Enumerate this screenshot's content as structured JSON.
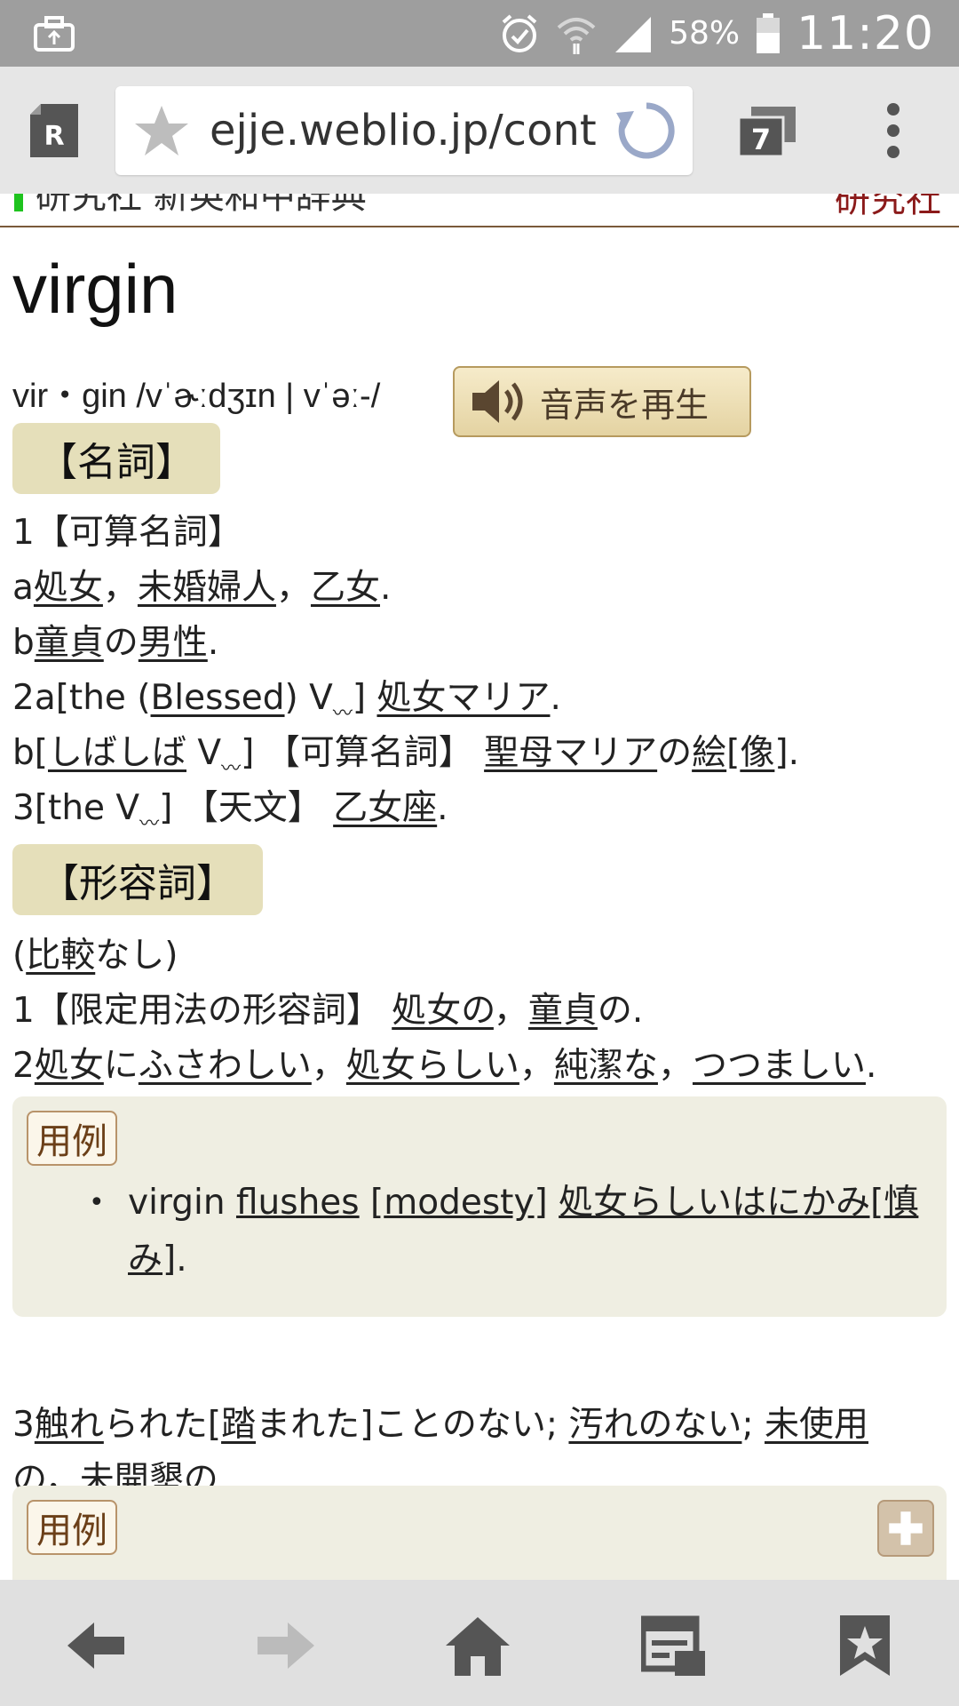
{
  "status": {
    "battery": "58%",
    "time": "11:20"
  },
  "browser": {
    "url": "ejje.weblio.jp/cont",
    "tab_count": "7"
  },
  "page": {
    "header_strip_text": "研究社 新英和中辞典",
    "header_logo": "研究社",
    "headword": "virgin",
    "pronunciation": "vir・gin /vˈɚːdʒɪn | vˈəː-/",
    "audio_button": "音声を再生",
    "noun_label": "【名詞】",
    "adj_label": "【形容詞】",
    "noun_1_header": "1【可算名詞】",
    "noun_1a": {
      "prefix": "a",
      "t1": "処女",
      "s1": "，",
      "t2": "未婚婦人",
      "s2": "，",
      "t3": "乙女",
      "end": "."
    },
    "noun_1b": {
      "prefix": "b",
      "t1": "童貞",
      "s1": "の",
      "t2": "男性",
      "end": "."
    },
    "noun_2a": {
      "prefix": "2a[the (",
      "t1": "Blessed",
      "s1": ") V",
      "tilde": "〰",
      "s2": "] ",
      "t2": "処女マリア",
      "end": "."
    },
    "noun_2b": {
      "prefix": "b[",
      "t1": "しばしば",
      "s1": " V",
      "tilde": "〰",
      "s2": "] 【可算名詞】 ",
      "t2": "聖母マリア",
      "s3": "の",
      "t3": "絵",
      "s4": "[",
      "t4": "像",
      "end": "]."
    },
    "noun_3": {
      "prefix": "3[the V",
      "tilde": "〰",
      "s1": "] 【天文】 ",
      "t1": "乙女座",
      "end": "."
    },
    "adj_0": {
      "prefix": "(",
      "t1": "比較",
      "end": "なし)"
    },
    "adj_1": {
      "prefix": "1【限定用法の形容詞】 ",
      "t1": "処女の",
      "s1": "，",
      "t2": "童貞",
      "end": "の."
    },
    "adj_2": {
      "prefix": "2",
      "t1": "処女",
      "s1": "に",
      "t2": "ふさわしい",
      "s2": "，",
      "t3": "処女らしい",
      "s3": "，",
      "t4": "純潔な",
      "s4": "，",
      "t5": "つつましい",
      "end": "."
    },
    "example_label": "用例",
    "example_1": {
      "bullet": "•",
      "s0": "virgin ",
      "t1": "flushes",
      "s1": " [",
      "t2": "modesty",
      "s2": "] ",
      "t3": "処女らしいはにかみ[慎",
      "t3b": "み",
      "end": "]."
    },
    "adj_3_line1": {
      "prefix": "3",
      "t1": "触れ",
      "s1": "られた[",
      "t2": "踏",
      "s2": "まれた]ことのない; ",
      "t3": "汚れのない",
      "s3": "; ",
      "t4": "未使用"
    },
    "adj_3_line2": {
      "t1": "の",
      "s1": "，",
      "t2": "未開墾の",
      "end": "."
    },
    "example_label_2": "用例"
  }
}
